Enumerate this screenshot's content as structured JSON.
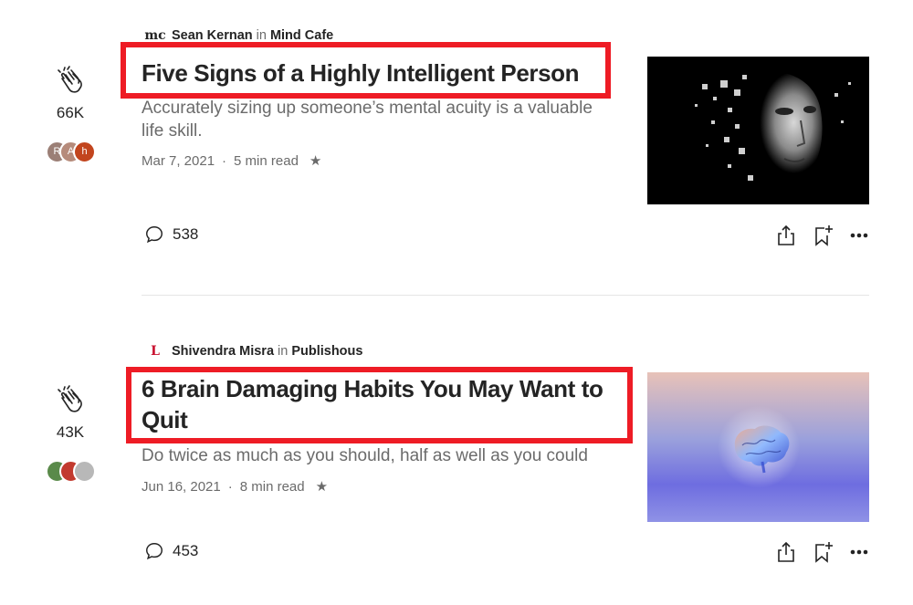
{
  "articles": [
    {
      "author": "Sean Kernan",
      "in_word": "in",
      "publication": "Mind Cafe",
      "publication_logo": "mc",
      "title": "Five Signs of a Highly Intelligent Person",
      "subtitle": "Accurately sizing up someone’s mental acuity is a valuable life skill.",
      "date": "Mar 7, 2021",
      "separator": "·",
      "read_time": "5 min read",
      "claps": "66K",
      "responses": "538",
      "avatar_initials": [
        "R",
        "A",
        "h"
      ],
      "thumbnail_icon": "pixelated-face-image"
    },
    {
      "author": "Shivendra Misra",
      "in_word": "in",
      "publication": "Publishous",
      "publication_logo": "L",
      "title": "6 Brain Damaging Habits You May Want to Quit",
      "subtitle": "Do twice as much as you should, half as well as you could",
      "date": "Jun 16, 2021",
      "separator": "·",
      "read_time": "8 min read",
      "claps": "43K",
      "responses": "453",
      "avatar_initials": [
        "",
        "",
        ""
      ],
      "thumbnail_icon": "glowing-brain-image"
    }
  ],
  "colors": {
    "highlight_box": "#ee1c25",
    "text_primary": "#242424",
    "text_secondary": "#6b6b6b"
  },
  "icons": {
    "clap": "clap-icon",
    "response": "speech-bubble-icon",
    "share": "share-icon",
    "bookmark": "bookmark-add-icon",
    "more": "more-dots-icon",
    "star": "★"
  }
}
